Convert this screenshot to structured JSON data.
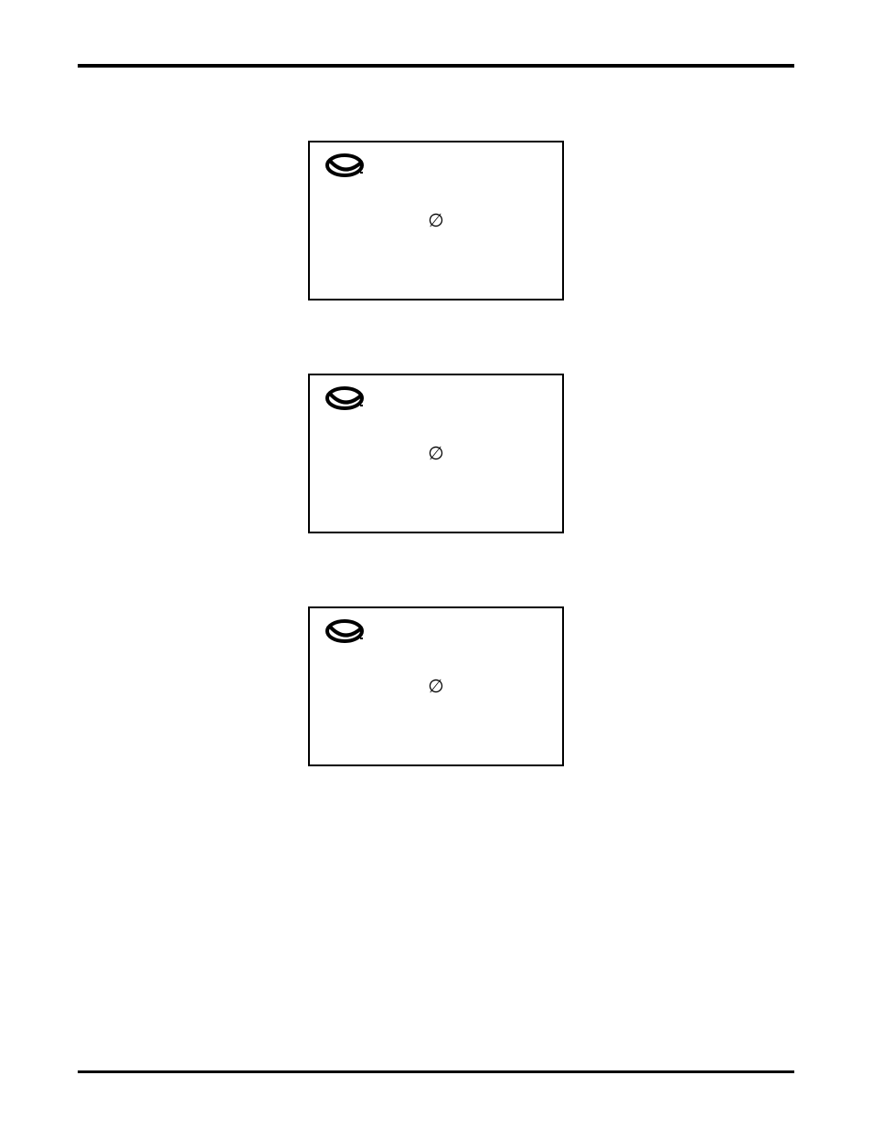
{
  "boxes": [
    {
      "glyph": "∅"
    },
    {
      "glyph": "∅"
    },
    {
      "glyph": "∅"
    }
  ]
}
